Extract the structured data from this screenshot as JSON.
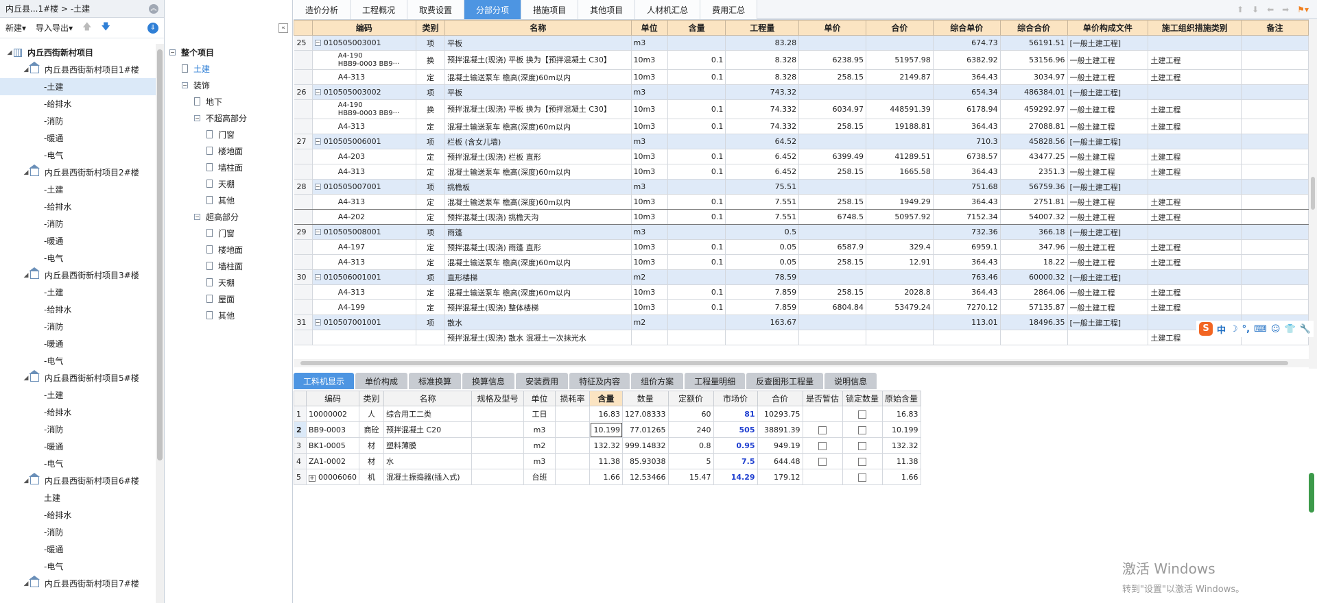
{
  "left_panel": {
    "title": "内丘县...1#楼 > -土建",
    "new_label": "新建",
    "import_export_label": "导入导出",
    "tree": [
      {
        "label": "内丘西街新村项目",
        "level": 0,
        "icon": "building-icon"
      },
      {
        "label": "内丘县西街新村项目1#楼",
        "level": 1,
        "icon": "house-icon"
      },
      {
        "label": "-土建",
        "level": 2,
        "selected": true
      },
      {
        "label": "-给排水",
        "level": 2
      },
      {
        "label": "-消防",
        "level": 2
      },
      {
        "label": "-暖通",
        "level": 2
      },
      {
        "label": "-电气",
        "level": 2
      },
      {
        "label": "内丘县西街新村项目2#楼",
        "level": 1,
        "icon": "house-icon"
      },
      {
        "label": "-土建",
        "level": 2
      },
      {
        "label": "-给排水",
        "level": 2
      },
      {
        "label": "-消防",
        "level": 2
      },
      {
        "label": "-暖通",
        "level": 2
      },
      {
        "label": "-电气",
        "level": 2
      },
      {
        "label": "内丘县西街新村项目3#楼",
        "level": 1,
        "icon": "house-icon"
      },
      {
        "label": "-土建",
        "level": 2
      },
      {
        "label": "-给排水",
        "level": 2
      },
      {
        "label": "-消防",
        "level": 2
      },
      {
        "label": "-暖通",
        "level": 2
      },
      {
        "label": "-电气",
        "level": 2
      },
      {
        "label": "内丘县西街新村项目5#楼",
        "level": 1,
        "icon": "house-icon"
      },
      {
        "label": "-土建",
        "level": 2
      },
      {
        "label": "-给排水",
        "level": 2
      },
      {
        "label": "-消防",
        "level": 2
      },
      {
        "label": "-暖通",
        "level": 2
      },
      {
        "label": "-电气",
        "level": 2
      },
      {
        "label": "内丘县西街新村项目6#楼",
        "level": 1,
        "icon": "house-icon"
      },
      {
        "label": "土建",
        "level": 2
      },
      {
        "label": "-给排水",
        "level": 2
      },
      {
        "label": "-消防",
        "level": 2
      },
      {
        "label": "-暖通",
        "level": 2
      },
      {
        "label": "-电气",
        "level": 2
      },
      {
        "label": "内丘县西街新村项目7#楼",
        "level": 1,
        "icon": "house-icon"
      }
    ]
  },
  "mid_panel": {
    "tree": [
      {
        "label": "整个项目",
        "level": 0,
        "box": "-",
        "bold": true
      },
      {
        "label": "土建",
        "level": 1,
        "doc": true,
        "highlight": true
      },
      {
        "label": "装饰",
        "level": 1,
        "box": "-"
      },
      {
        "label": "地下",
        "level": 2,
        "doc": true
      },
      {
        "label": "不超高部分",
        "level": 2,
        "box": "-"
      },
      {
        "label": "门窗",
        "level": 3,
        "doc": true
      },
      {
        "label": "楼地面",
        "level": 3,
        "doc": true
      },
      {
        "label": "墙柱面",
        "level": 3,
        "doc": true
      },
      {
        "label": "天棚",
        "level": 3,
        "doc": true
      },
      {
        "label": "其他",
        "level": 3,
        "doc": true
      },
      {
        "label": "超高部分",
        "level": 2,
        "box": "-"
      },
      {
        "label": "门窗",
        "level": 3,
        "doc": true
      },
      {
        "label": "楼地面",
        "level": 3,
        "doc": true
      },
      {
        "label": "墙柱面",
        "level": 3,
        "doc": true
      },
      {
        "label": "天棚",
        "level": 3,
        "doc": true
      },
      {
        "label": "屋面",
        "level": 3,
        "doc": true
      },
      {
        "label": "其他",
        "level": 3,
        "doc": true
      }
    ]
  },
  "tabs": [
    {
      "label": "造价分析"
    },
    {
      "label": "工程概况"
    },
    {
      "label": "取费设置"
    },
    {
      "label": "分部分项",
      "active": true
    },
    {
      "label": "措施项目"
    },
    {
      "label": "其他项目"
    },
    {
      "label": "人材机汇总"
    },
    {
      "label": "费用汇总"
    }
  ],
  "main_table": {
    "headers": [
      "",
      "编码",
      "类别",
      "名称",
      "单位",
      "含量",
      "工程量",
      "单价",
      "合价",
      "综合单价",
      "综合合价",
      "单价构成文件",
      "施工组织措施类别",
      "备注"
    ],
    "rows": [
      {
        "type": "xiang",
        "no": "25",
        "code": "010505003001",
        "cat": "项",
        "name": "平板",
        "unit": "m3",
        "content": "",
        "qty": "83.28",
        "price": "",
        "total": "",
        "uprice": "674.73",
        "utotal": "56191.51",
        "file": "[一般土建工程]",
        "org": "",
        "note": ""
      },
      {
        "type": "sub",
        "tall": true,
        "no": "",
        "code": "A4-190\nHBB9-0003 BB9···",
        "cat": "换",
        "name": "预拌混凝土(现浇) 平板  换为【预拌混凝土 C30】",
        "unit": "10m3",
        "content": "0.1",
        "qty": "8.328",
        "price": "6238.95",
        "total": "51957.98",
        "uprice": "6382.92",
        "utotal": "53156.96",
        "file": "一般土建工程",
        "org": "土建工程",
        "note": ""
      },
      {
        "type": "sub",
        "no": "",
        "code": "A4-313",
        "cat": "定",
        "name": "混凝土输送泵车 檐高(深度)60m以内",
        "unit": "10m3",
        "content": "0.1",
        "qty": "8.328",
        "price": "258.15",
        "total": "2149.87",
        "uprice": "364.43",
        "utotal": "3034.97",
        "file": "一般土建工程",
        "org": "土建工程",
        "note": ""
      },
      {
        "type": "xiang",
        "no": "26",
        "code": "010505003002",
        "cat": "项",
        "name": "平板",
        "unit": "m3",
        "content": "",
        "qty": "743.32",
        "price": "",
        "total": "",
        "uprice": "654.34",
        "utotal": "486384.01",
        "file": "[一般土建工程]",
        "org": "",
        "note": ""
      },
      {
        "type": "sub",
        "tall": true,
        "no": "",
        "code": "A4-190\nHBB9-0003 BB9···",
        "cat": "换",
        "name": "预拌混凝土(现浇) 平板  换为【预拌混凝土 C30】",
        "unit": "10m3",
        "content": "0.1",
        "qty": "74.332",
        "price": "6034.97",
        "total": "448591.39",
        "uprice": "6178.94",
        "utotal": "459292.97",
        "file": "一般土建工程",
        "org": "土建工程",
        "note": ""
      },
      {
        "type": "sub",
        "no": "",
        "code": "A4-313",
        "cat": "定",
        "name": "混凝土输送泵车 檐高(深度)60m以内",
        "unit": "10m3",
        "content": "0.1",
        "qty": "74.332",
        "price": "258.15",
        "total": "19188.81",
        "uprice": "364.43",
        "utotal": "27088.81",
        "file": "一般土建工程",
        "org": "土建工程",
        "note": ""
      },
      {
        "type": "xiang",
        "no": "27",
        "code": "010505006001",
        "cat": "项",
        "name": "栏板 (含女儿墙)",
        "unit": "m3",
        "content": "",
        "qty": "64.52",
        "price": "",
        "total": "",
        "uprice": "710.3",
        "utotal": "45828.56",
        "file": "[一般土建工程]",
        "org": "",
        "note": ""
      },
      {
        "type": "sub",
        "no": "",
        "code": "A4-203",
        "cat": "定",
        "name": "预拌混凝土(现浇) 栏板 直形",
        "unit": "10m3",
        "content": "0.1",
        "qty": "6.452",
        "price": "6399.49",
        "total": "41289.51",
        "uprice": "6738.57",
        "utotal": "43477.25",
        "file": "一般土建工程",
        "org": "土建工程",
        "note": ""
      },
      {
        "type": "sub",
        "no": "",
        "code": "A4-313",
        "cat": "定",
        "name": "混凝土输送泵车 檐高(深度)60m以内",
        "unit": "10m3",
        "content": "0.1",
        "qty": "6.452",
        "price": "258.15",
        "total": "1665.58",
        "uprice": "364.43",
        "utotal": "2351.3",
        "file": "一般土建工程",
        "org": "土建工程",
        "note": ""
      },
      {
        "type": "xiang",
        "no": "28",
        "code": "010505007001",
        "cat": "项",
        "name": "挑檐板",
        "unit": "m3",
        "content": "",
        "qty": "75.51",
        "price": "",
        "total": "",
        "uprice": "751.68",
        "utotal": "56759.36",
        "file": "[一般土建工程]",
        "org": "",
        "note": ""
      },
      {
        "type": "sub",
        "selected": true,
        "no": "",
        "code": "A4-313",
        "cat": "定",
        "name": "混凝土输送泵车 檐高(深度)60m以内",
        "unit": "10m3",
        "content": "0.1",
        "qty": "7.551",
        "price": "258.15",
        "total": "1949.29",
        "uprice": "364.43",
        "utotal": "2751.81",
        "file": "一般土建工程",
        "org": "土建工程",
        "note": ""
      },
      {
        "type": "sub",
        "selected": true,
        "no": "",
        "code": "A4-202",
        "cat": "定",
        "name": "预拌混凝土(现浇) 挑檐天沟",
        "unit": "10m3",
        "content": "0.1",
        "qty": "7.551",
        "price": "6748.5",
        "total": "50957.92",
        "uprice": "7152.34",
        "utotal": "54007.32",
        "file": "一般土建工程",
        "org": "土建工程",
        "note": ""
      },
      {
        "type": "xiang",
        "no": "29",
        "code": "010505008001",
        "cat": "项",
        "name": "雨篷",
        "unit": "m3",
        "content": "",
        "qty": "0.5",
        "price": "",
        "total": "",
        "uprice": "732.36",
        "utotal": "366.18",
        "file": "[一般土建工程]",
        "org": "",
        "note": ""
      },
      {
        "type": "sub",
        "no": "",
        "code": "A4-197",
        "cat": "定",
        "name": "预拌混凝土(现浇) 雨篷 直形",
        "unit": "10m3",
        "content": "0.1",
        "qty": "0.05",
        "price": "6587.9",
        "total": "329.4",
        "uprice": "6959.1",
        "utotal": "347.96",
        "file": "一般土建工程",
        "org": "土建工程",
        "note": ""
      },
      {
        "type": "sub",
        "no": "",
        "code": "A4-313",
        "cat": "定",
        "name": "混凝土输送泵车 檐高(深度)60m以内",
        "unit": "10m3",
        "content": "0.1",
        "qty": "0.05",
        "price": "258.15",
        "total": "12.91",
        "uprice": "364.43",
        "utotal": "18.22",
        "file": "一般土建工程",
        "org": "土建工程",
        "note": ""
      },
      {
        "type": "xiang",
        "no": "30",
        "code": "010506001001",
        "cat": "项",
        "name": "直形楼梯",
        "unit": "m2",
        "content": "",
        "qty": "78.59",
        "price": "",
        "total": "",
        "uprice": "763.46",
        "utotal": "60000.32",
        "file": "[一般土建工程]",
        "org": "",
        "note": ""
      },
      {
        "type": "sub",
        "no": "",
        "code": "A4-313",
        "cat": "定",
        "name": "混凝土输送泵车 檐高(深度)60m以内",
        "unit": "10m3",
        "content": "0.1",
        "qty": "7.859",
        "price": "258.15",
        "total": "2028.8",
        "uprice": "364.43",
        "utotal": "2864.06",
        "file": "一般土建工程",
        "org": "土建工程",
        "note": ""
      },
      {
        "type": "sub",
        "no": "",
        "code": "A4-199",
        "cat": "定",
        "name": "预拌混凝土(现浇) 整体楼梯",
        "unit": "10m3",
        "content": "0.1",
        "qty": "7.859",
        "price": "6804.84",
        "total": "53479.24",
        "uprice": "7270.12",
        "utotal": "57135.87",
        "file": "一般土建工程",
        "org": "土建工程",
        "note": ""
      },
      {
        "type": "xiang",
        "no": "31",
        "code": "010507001001",
        "cat": "项",
        "name": "散水",
        "unit": "m2",
        "content": "",
        "qty": "163.67",
        "price": "",
        "total": "",
        "uprice": "113.01",
        "utotal": "18496.35",
        "file": "[一般土建工程]",
        "org": "",
        "note": ""
      },
      {
        "type": "sub",
        "no": "",
        "code": "",
        "cat": "",
        "name": "预拌混凝土(现浇) 散水 混凝土一次抹光水",
        "unit": "",
        "content": "",
        "qty": "",
        "price": "",
        "total": "",
        "uprice": "",
        "utotal": "",
        "file": "",
        "org": "土建工程",
        "note": ""
      }
    ]
  },
  "ime": {
    "label": "中",
    "moon": "☽",
    "dot": "°,"
  },
  "bottom_tabs": [
    {
      "label": "工料机显示",
      "active": true
    },
    {
      "label": "单价构成"
    },
    {
      "label": "标准换算"
    },
    {
      "label": "换算信息"
    },
    {
      "label": "安装费用"
    },
    {
      "label": "特征及内容"
    },
    {
      "label": "组价方案"
    },
    {
      "label": "工程量明细"
    },
    {
      "label": "反查图形工程量"
    },
    {
      "label": "说明信息"
    }
  ],
  "bottom_table": {
    "headers": [
      "",
      "编码",
      "类别",
      "名称",
      "规格及型号",
      "单位",
      "损耗率",
      "含量",
      "数量",
      "定额价",
      "市场价",
      "合价",
      "是否暂估",
      "锁定数量",
      "原始含量"
    ],
    "rows": [
      {
        "no": "1",
        "code": "10000002",
        "cat": "人",
        "name": "综合用工二类",
        "spec": "",
        "unit": "工日",
        "loss": "",
        "content": "16.83",
        "qty": "127.08333",
        "dprice": "60",
        "mprice": "81",
        "total": "10293.75",
        "est": false,
        "lock": true,
        "orig": "16.83"
      },
      {
        "no": "2",
        "code": "BB9-0003",
        "cat": "商砼",
        "name": "预拌混凝土 C20",
        "spec": "",
        "unit": "m3",
        "loss": "",
        "content": "10.199",
        "qty": "77.01265",
        "dprice": "240",
        "mprice": "505",
        "total": "38891.39",
        "est": true,
        "lock": true,
        "orig": "10.199",
        "current": true
      },
      {
        "no": "3",
        "code": "BK1-0005",
        "cat": "材",
        "name": "塑料薄膜",
        "spec": "",
        "unit": "m2",
        "loss": "",
        "content": "132.32",
        "qty": "999.14832",
        "dprice": "0.8",
        "mprice": "0.95",
        "total": "949.19",
        "est": true,
        "lock": true,
        "orig": "132.32"
      },
      {
        "no": "4",
        "code": "ZA1-0002",
        "cat": "材",
        "name": "水",
        "spec": "",
        "unit": "m3",
        "loss": "",
        "content": "11.38",
        "qty": "85.93038",
        "dprice": "5",
        "mprice": "7.5",
        "total": "644.48",
        "est": true,
        "lock": true,
        "orig": "11.38"
      },
      {
        "no": "5",
        "code": "00006060",
        "cat": "机",
        "name": "混凝土振捣器(插入式)",
        "spec": "",
        "unit": "台班",
        "loss": "",
        "content": "1.66",
        "qty": "12.53466",
        "dprice": "15.47",
        "mprice": "14.29",
        "total": "179.12",
        "est": false,
        "lock": true,
        "orig": "1.66",
        "expand": true
      }
    ]
  },
  "watermark": {
    "line1": "激活 Windows",
    "line2": "转到\"设置\"以激活 Windows。"
  }
}
